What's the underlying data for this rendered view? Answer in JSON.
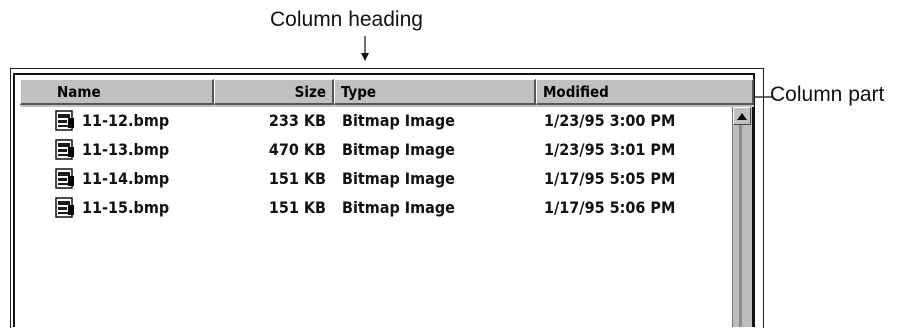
{
  "callouts": {
    "column_heading": "Column heading",
    "column_part": "Column part"
  },
  "headers": {
    "name": "Name",
    "size": "Size",
    "type": "Type",
    "modified": "Modified"
  },
  "rows": [
    {
      "name": "11-12.bmp",
      "size": "233 KB",
      "type": "Bitmap Image",
      "modified": "1/23/95 3:00 PM",
      "icon": "bitmap-file-icon"
    },
    {
      "name": "11-13.bmp",
      "size": "470 KB",
      "type": "Bitmap Image",
      "modified": "1/23/95 3:01 PM",
      "icon": "bitmap-file-icon"
    },
    {
      "name": "11-14.bmp",
      "size": "151 KB",
      "type": "Bitmap Image",
      "modified": "1/17/95 5:05 PM",
      "icon": "bitmap-file-icon"
    },
    {
      "name": "11-15.bmp",
      "size": "151 KB",
      "type": "Bitmap Image",
      "modified": "1/17/95 5:06 PM",
      "icon": "bitmap-file-icon"
    }
  ],
  "colors": {
    "header_bg": "#c0c0c0",
    "row_text": "#111111"
  },
  "scrollbar_up_icon": "up-arrow-icon"
}
